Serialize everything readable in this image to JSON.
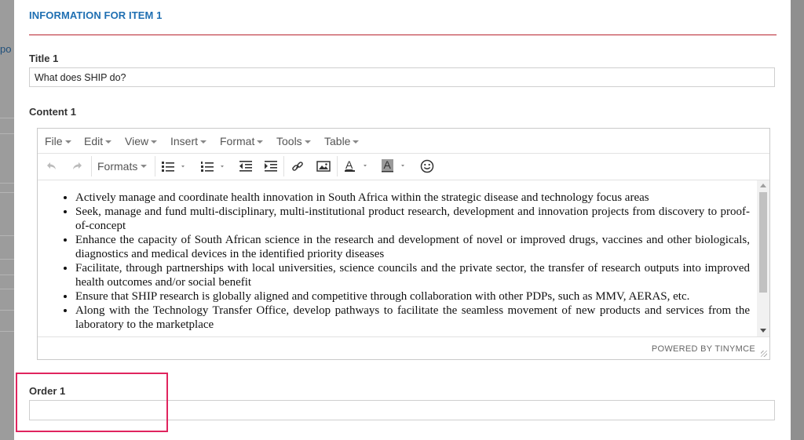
{
  "background": {
    "fragment_text": "po"
  },
  "modal": {
    "section_title": "INFORMATION FOR ITEM 1",
    "accent_color": "#b9232f",
    "title_color": "#1f6fb2"
  },
  "title_field": {
    "label": "Title 1",
    "value": "What does SHIP do?"
  },
  "content_field": {
    "label": "Content 1"
  },
  "editor": {
    "menus": [
      "File",
      "Edit",
      "View",
      "Insert",
      "Format",
      "Tools",
      "Table"
    ],
    "formats_label": "Formats",
    "toolbar_icons": [
      "undo-icon",
      "redo-icon",
      "bullet-list-icon",
      "numbered-list-icon",
      "outdent-icon",
      "indent-icon",
      "link-icon",
      "image-icon",
      "text-color-icon",
      "background-color-icon",
      "emoticons-icon"
    ],
    "content_items": [
      "Actively manage and coordinate health innovation in South Africa within the strategic disease and technology focus areas",
      "Seek, manage and fund multi-disciplinary, multi-institutional product research, development and innovation projects from discovery to proof-of-concept",
      "Enhance the capacity of South African science in the research and development of novel or improved drugs, vaccines and other biologicals, diagnostics and medical devices in the identified priority diseases",
      "Facilitate, through partnerships with local universities, science councils and the private sector, the transfer of research outputs into improved health outcomes and/or social benefit",
      "Ensure that SHIP research is globally aligned and competitive through collaboration with other PDPs, such as MMV, AERAS, etc.",
      "Along with the Technology Transfer Office, develop pathways to facilitate the seamless movement of new products and services from the laboratory to the marketplace"
    ],
    "powered_by": "POWERED BY TINYMCE"
  },
  "order_field": {
    "label": "Order 1",
    "value": "",
    "highlight_color": "#e0245e"
  }
}
